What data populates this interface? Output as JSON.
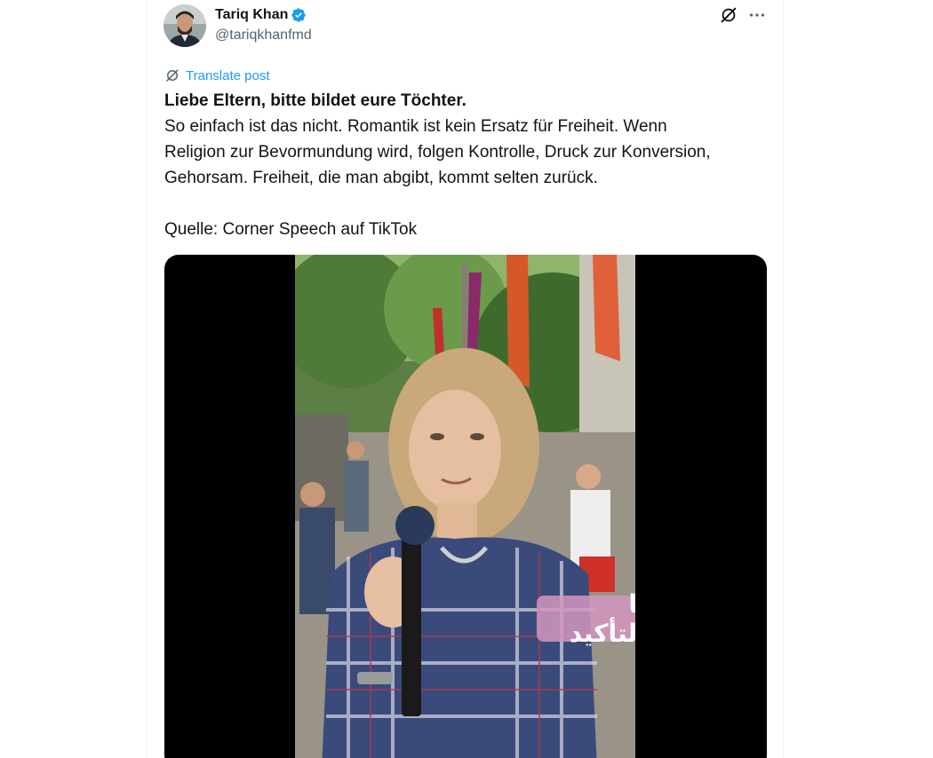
{
  "author": {
    "display_name": "Tariq Khan",
    "handle": "@tariqkhanfmd",
    "verified": true,
    "avatar_icon": "avatar-photo"
  },
  "actions": {
    "grok_icon": "grok-icon",
    "more_icon": "more-dots-icon"
  },
  "translate": {
    "label": "Translate post",
    "color": "#1d9bf0"
  },
  "post": {
    "headline": "Liebe Eltern, bitte bildet eure Töchter.",
    "body_lines": [
      "So einfach ist das nicht. Romantik ist kein Ersatz für Freiheit. Wenn",
      "Religion zur Bevormundung wird, folgen Kontrolle, Druck zur Konversion,",
      "Gehorsam. Freiheit, die man abgibt, kommt selten zurück."
    ],
    "source": "Quelle: Corner Speech auf TikTok"
  },
  "media": {
    "subtitle": "أنا بالتأكيد"
  }
}
